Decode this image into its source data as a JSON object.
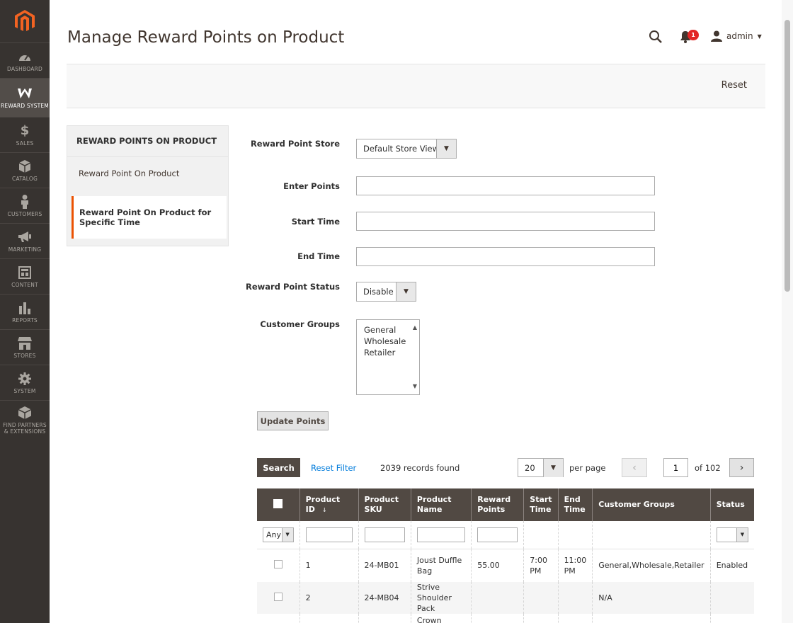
{
  "sidebar": {
    "items": [
      {
        "label": "DASHBOARD",
        "icon": "dashboard-icon"
      },
      {
        "label": "REWARD SYSTEM",
        "icon": "reward-icon"
      },
      {
        "label": "SALES",
        "icon": "dollar-icon"
      },
      {
        "label": "CATALOG",
        "icon": "catalog-box-icon"
      },
      {
        "label": "CUSTOMERS",
        "icon": "customers-icon"
      },
      {
        "label": "MARKETING",
        "icon": "megaphone-icon"
      },
      {
        "label": "CONTENT",
        "icon": "content-icon"
      },
      {
        "label": "REPORTS",
        "icon": "bar-chart-icon"
      },
      {
        "label": "STORES",
        "icon": "store-icon"
      },
      {
        "label": "SYSTEM",
        "icon": "gear-icon"
      },
      {
        "label": "FIND PARTNERS & EXTENSIONS",
        "icon": "partners-icon"
      }
    ]
  },
  "header": {
    "title": "Manage Reward Points on Product",
    "notification_count": "1",
    "user": "admin"
  },
  "actions": {
    "reset": "Reset"
  },
  "tabs": {
    "title": "REWARD POINTS ON PRODUCT",
    "items": [
      "Reward Point On Product",
      "Reward Point On Product for Specific Time"
    ]
  },
  "form": {
    "store_label": "Reward Point Store",
    "store_value": "Default Store View",
    "points_label": "Enter Points",
    "start_label": "Start Time",
    "end_label": "End Time",
    "status_label": "Reward Point Status",
    "status_value": "Disable",
    "groups_label": "Customer Groups",
    "groups": [
      "General",
      "Wholesale",
      "Retailer"
    ],
    "update_button": "Update Points"
  },
  "grid_toolbar": {
    "search": "Search",
    "reset_filter": "Reset Filter",
    "records": "2039 records found",
    "per_page_value": "20",
    "per_page_label": "per page",
    "page": "1",
    "of_pages": "of 102"
  },
  "table": {
    "columns": [
      "Product ID",
      "Product SKU",
      "Product Name",
      "Reward Points",
      "Start Time",
      "End Time",
      "Customer Groups",
      "Status"
    ],
    "filter_any": "Any",
    "rows": [
      {
        "id": "1",
        "sku": "24-MB01",
        "name": "Joust Duffle Bag",
        "points": "55.00",
        "start": "7:00 PM",
        "end": "11:00 PM",
        "groups": "General,Wholesale,Retailer",
        "status": "Enabled"
      },
      {
        "id": "2",
        "sku": "24-MB04",
        "name": "Strive Shoulder Pack",
        "points": "",
        "start": "",
        "end": "",
        "groups": "N/A",
        "status": ""
      },
      {
        "id": "",
        "sku": "",
        "name": "Crown Summit",
        "points": "",
        "start": "",
        "end": "",
        "groups": "",
        "status": ""
      }
    ]
  },
  "colors": {
    "accent": "#eb5202",
    "sidebar": "#373330",
    "table_header": "#514943",
    "link": "#007bdb"
  }
}
